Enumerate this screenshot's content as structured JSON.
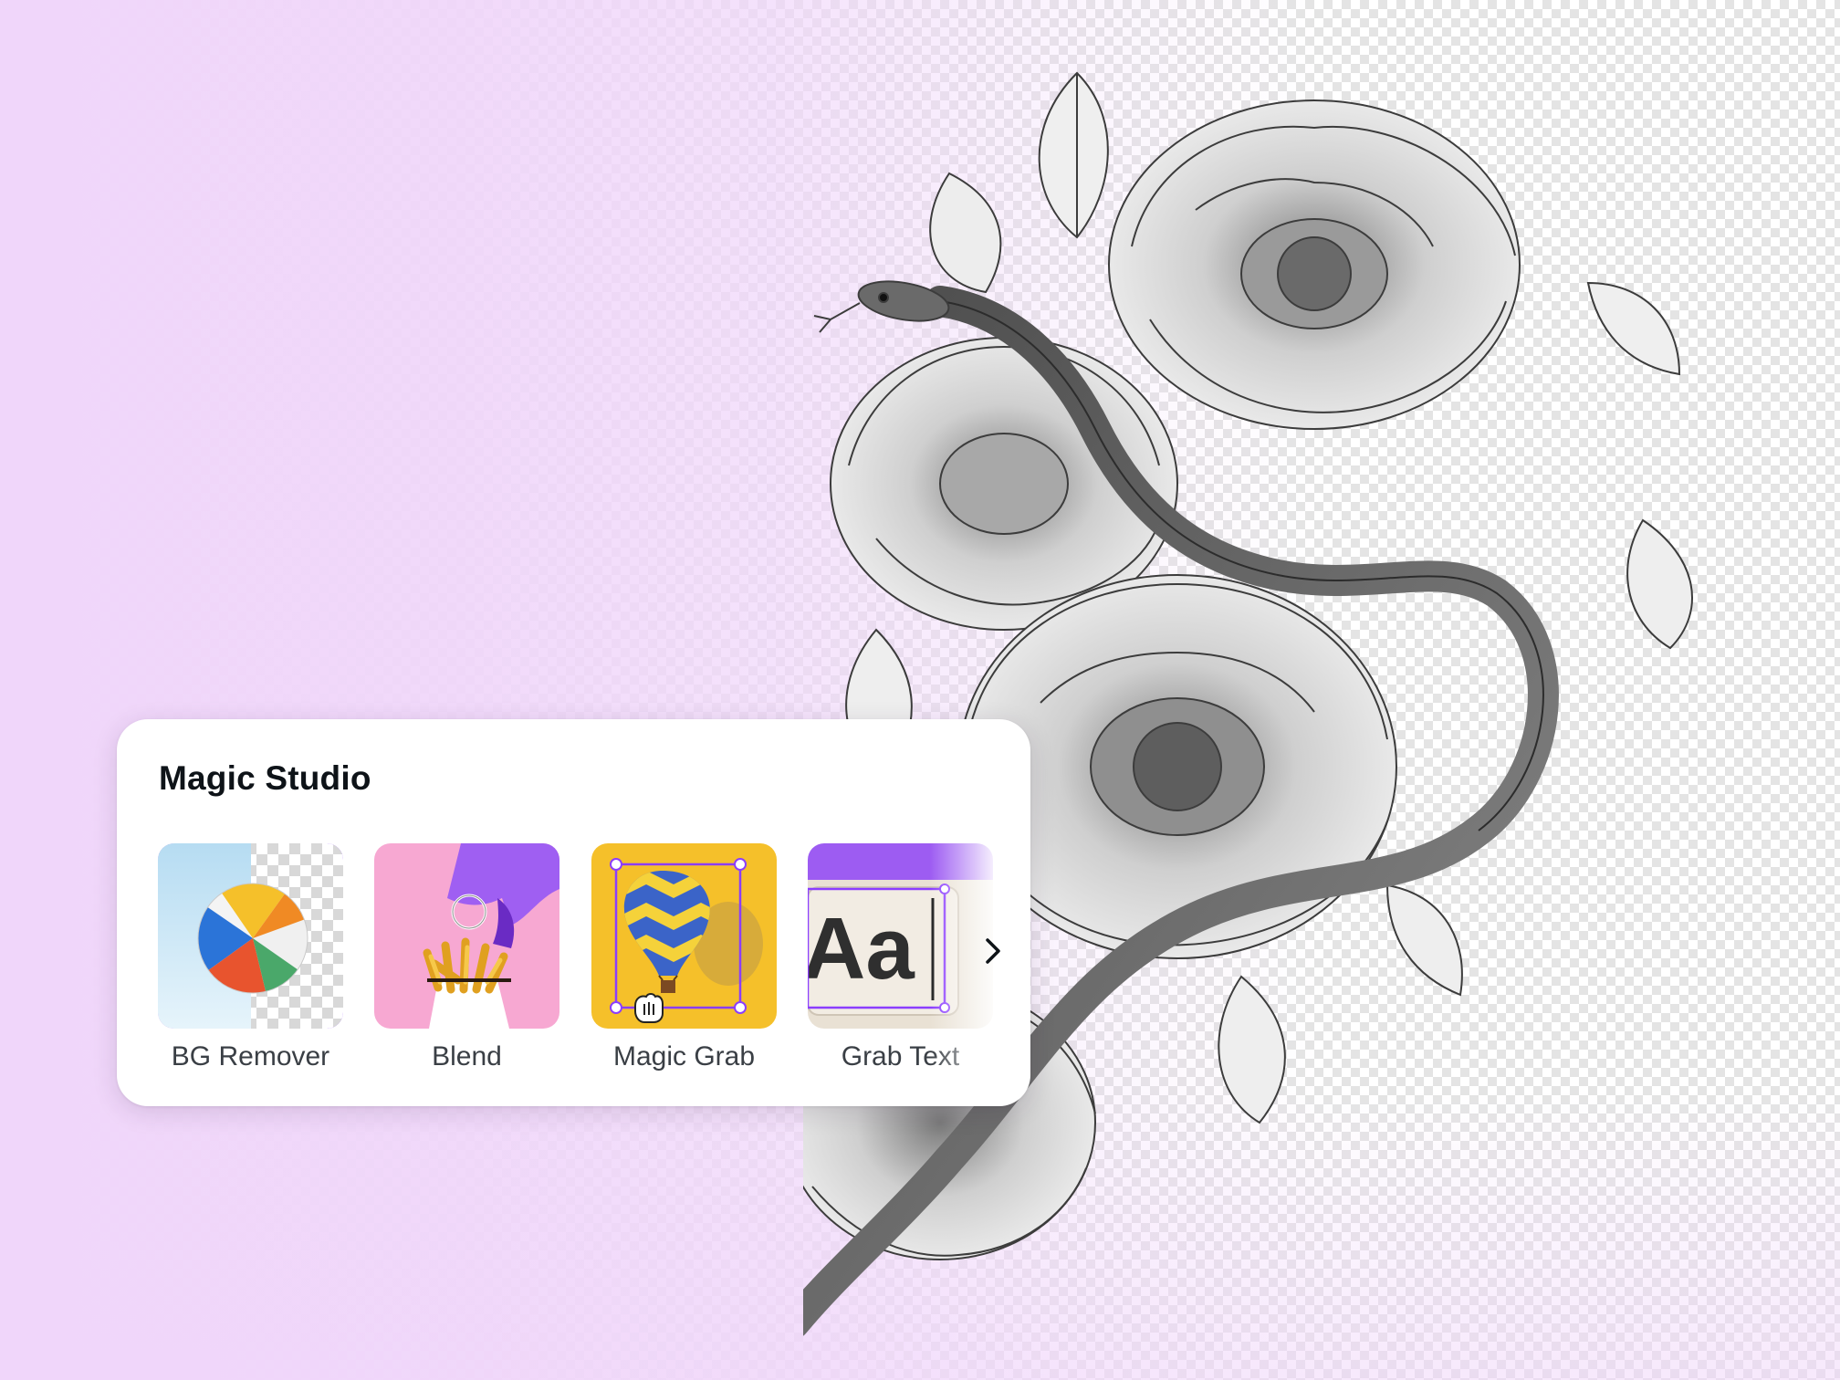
{
  "panel": {
    "title": "Magic Studio",
    "tools": [
      {
        "label": "BG Remover",
        "icon": "beach-ball-bg-remove-thumbnail",
        "selected": true
      },
      {
        "label": "Blend",
        "icon": "fries-blend-thumbnail",
        "selected": false
      },
      {
        "label": "Magic Grab",
        "icon": "hot-air-balloon-grab-thumbnail",
        "selected": false
      },
      {
        "label": "Grab Text",
        "icon": "text-aa-grab-thumbnail",
        "selected": false
      }
    ],
    "next_icon": "chevron-right-icon",
    "grab_text_sample": "Aa"
  },
  "artwork": {
    "icon": "peony-snake-sketch"
  },
  "colors": {
    "accent": "#8b3dff",
    "background_tint": "#f0d6fa",
    "title": "#0e1318",
    "label": "#3a3f45"
  }
}
